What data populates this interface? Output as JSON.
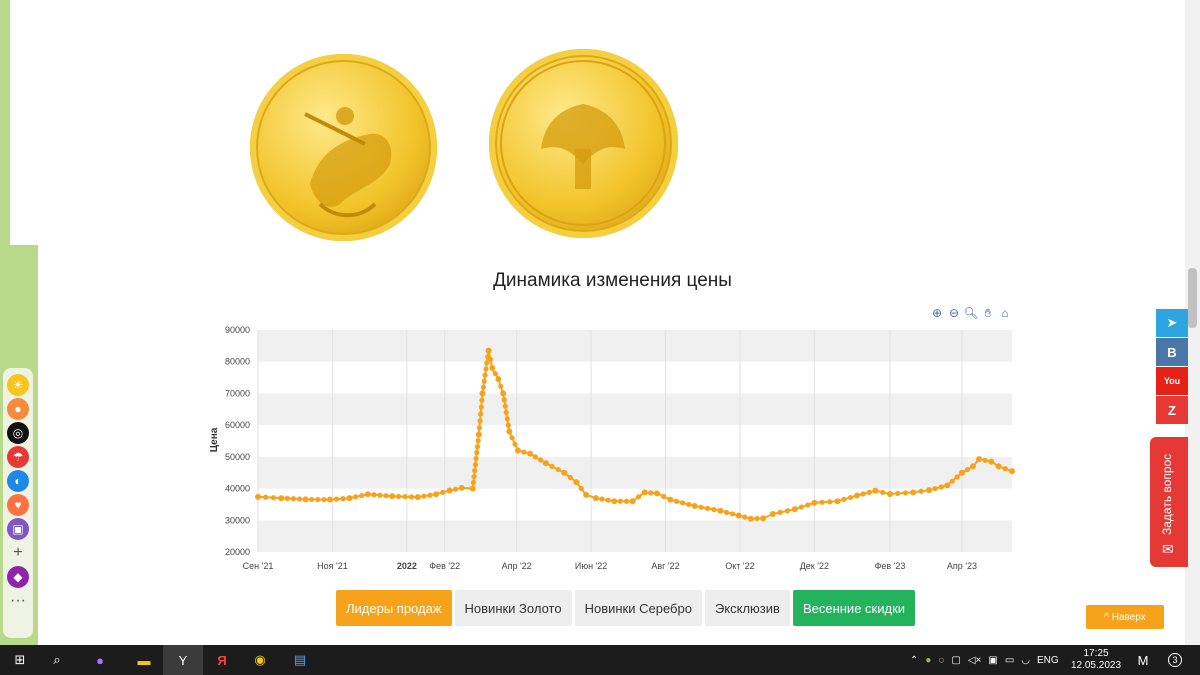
{
  "chart_title": "Динамика изменения цены",
  "tabs": [
    {
      "label": "Лидеры продаж",
      "state": "active"
    },
    {
      "label": "Новинки Золото",
      "state": "normal"
    },
    {
      "label": "Новинки Серебро",
      "state": "normal"
    },
    {
      "label": "Эксклюзив",
      "state": "normal"
    },
    {
      "label": "Весенние скидки",
      "state": "green"
    }
  ],
  "scroll_up_label": "^ Наверх",
  "ask_question_label": "Задать вопрос",
  "social": [
    {
      "icon": "telegram-icon",
      "glyph": "➤",
      "color": "#2ca5e0"
    },
    {
      "icon": "vk-icon",
      "glyph": "В",
      "color": "#4a76a8"
    },
    {
      "icon": "youtube-icon",
      "glyph": "You",
      "color": "#e62117"
    },
    {
      "icon": "zen-icon",
      "glyph": "Z",
      "color": "#e53935"
    }
  ],
  "colors": {
    "accent": "#f7a21b",
    "green": "#23b35c",
    "line": "#f7a21b"
  },
  "taskbar": {
    "lang": "ENG",
    "time": "17:25",
    "date": "12.05.2023",
    "notifications": "3"
  },
  "chart_data": {
    "type": "line",
    "title": "Динамика изменения цены",
    "ylabel": "Цена",
    "xlabel": "",
    "ylim": [
      20000,
      90000
    ],
    "y_ticks": [
      "20000",
      "30000",
      "40000",
      "50000",
      "60000",
      "70000",
      "80000",
      "90000"
    ],
    "x_ticks": [
      "Сен '21",
      "Ноя '21",
      "2022",
      "Фев '22",
      "Апр '22",
      "Июн '22",
      "Авг '22",
      "Окт '22",
      "Дек '22",
      "Фев '23",
      "Апр '23"
    ],
    "x_tick_dates": [
      "2021-09-01",
      "2021-11-01",
      "2022-01-01",
      "2022-02-01",
      "2022-04-01",
      "2022-06-01",
      "2022-08-01",
      "2022-10-01",
      "2022-12-01",
      "2023-02-01",
      "2023-04-01"
    ],
    "x_range": [
      "2021-09-01",
      "2023-05-12"
    ],
    "grid": true,
    "series": [
      {
        "points": [
          [
            "2021-09-01",
            37400
          ],
          [
            "2021-09-20",
            37000
          ],
          [
            "2021-10-10",
            36600
          ],
          [
            "2021-10-30",
            36500
          ],
          [
            "2021-11-15",
            37000
          ],
          [
            "2021-11-30",
            38200
          ],
          [
            "2021-12-20",
            37600
          ],
          [
            "2022-01-10",
            37300
          ],
          [
            "2022-01-25",
            38200
          ],
          [
            "2022-02-05",
            39400
          ],
          [
            "2022-02-15",
            40200
          ],
          [
            "2022-02-24",
            40000
          ],
          [
            "2022-03-01",
            57000
          ],
          [
            "2022-03-04",
            70000
          ],
          [
            "2022-03-09",
            83500
          ],
          [
            "2022-03-12",
            78000
          ],
          [
            "2022-03-17",
            74500
          ],
          [
            "2022-03-21",
            70000
          ],
          [
            "2022-03-26",
            58000
          ],
          [
            "2022-04-02",
            52000
          ],
          [
            "2022-04-12",
            51000
          ],
          [
            "2022-04-25",
            48000
          ],
          [
            "2022-05-10",
            45000
          ],
          [
            "2022-05-20",
            42000
          ],
          [
            "2022-05-28",
            38000
          ],
          [
            "2022-06-05",
            37000
          ],
          [
            "2022-06-20",
            36000
          ],
          [
            "2022-07-05",
            36000
          ],
          [
            "2022-07-15",
            38800
          ],
          [
            "2022-07-25",
            38500
          ],
          [
            "2022-08-05",
            36500
          ],
          [
            "2022-08-25",
            34500
          ],
          [
            "2022-09-15",
            33000
          ],
          [
            "2022-09-30",
            31500
          ],
          [
            "2022-10-10",
            30500
          ],
          [
            "2022-10-20",
            30600
          ],
          [
            "2022-10-28",
            32000
          ],
          [
            "2022-11-15",
            33500
          ],
          [
            "2022-12-01",
            35500
          ],
          [
            "2022-12-20",
            36000
          ],
          [
            "2023-01-05",
            37800
          ],
          [
            "2023-01-20",
            39300
          ],
          [
            "2023-02-01",
            38300
          ],
          [
            "2023-02-20",
            38800
          ],
          [
            "2023-03-05",
            39500
          ],
          [
            "2023-03-20",
            41000
          ],
          [
            "2023-04-01",
            45000
          ],
          [
            "2023-04-10",
            47000
          ],
          [
            "2023-04-15",
            49300
          ],
          [
            "2023-04-25",
            48500
          ],
          [
            "2023-05-01",
            47000
          ],
          [
            "2023-05-12",
            45500
          ]
        ]
      }
    ]
  }
}
